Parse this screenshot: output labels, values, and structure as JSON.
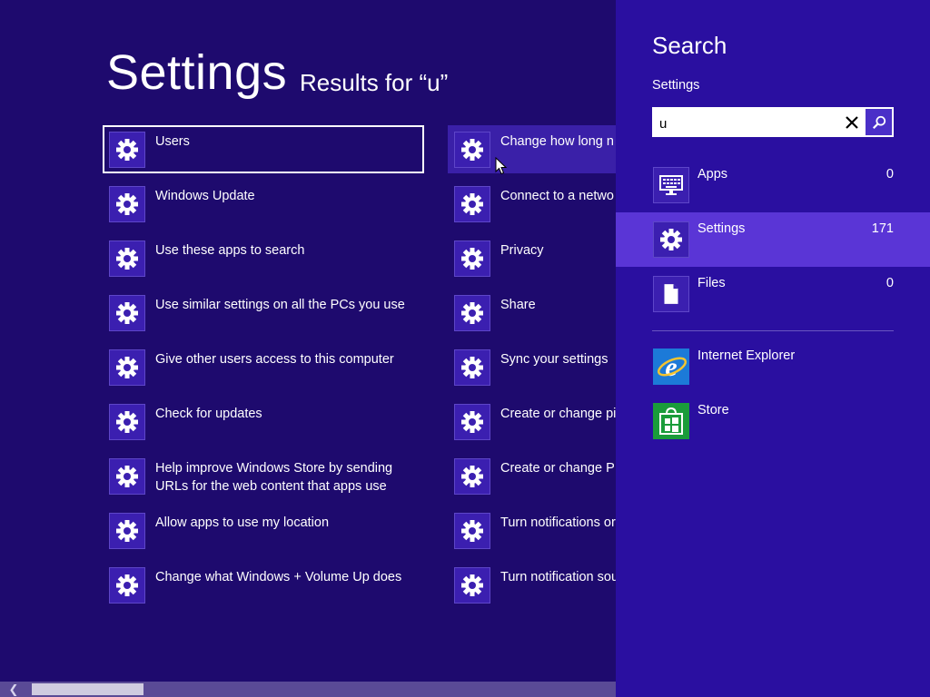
{
  "header": {
    "title": "Settings",
    "subtitle": "Results for “u”"
  },
  "results": {
    "left": [
      {
        "label": "Users"
      },
      {
        "label": "Windows Update"
      },
      {
        "label": "Use these apps to search"
      },
      {
        "label": "Use similar settings on all the PCs you use"
      },
      {
        "label": "Give other users access to this computer"
      },
      {
        "label": "Check for updates"
      },
      {
        "label": "Help improve Windows Store by sending URLs for the web content that apps use"
      },
      {
        "label": "Allow apps to use my location"
      },
      {
        "label": "Change what Windows + Volume Up does"
      }
    ],
    "right": [
      {
        "label": "Change how long n"
      },
      {
        "label": "Connect to a netwo"
      },
      {
        "label": "Privacy"
      },
      {
        "label": "Share"
      },
      {
        "label": "Sync your settings"
      },
      {
        "label": "Create or change pi"
      },
      {
        "label": "Create or change PI"
      },
      {
        "label": "Turn notifications or"
      },
      {
        "label": "Turn notification sou"
      }
    ]
  },
  "search": {
    "title": "Search",
    "scope": "Settings",
    "query": "u",
    "filters": [
      {
        "label": "Apps",
        "count": "0",
        "icon": "apps-icon"
      },
      {
        "label": "Settings",
        "count": "171",
        "icon": "gear-icon"
      },
      {
        "label": "Files",
        "count": "0",
        "icon": "file-icon"
      }
    ],
    "apps": [
      {
        "label": "Internet Explorer",
        "icon": "internet-explorer-icon"
      },
      {
        "label": "Store",
        "icon": "store-icon"
      }
    ]
  },
  "colors": {
    "background": "#1e0a6e",
    "charm_background": "#2a0fa0",
    "highlight": "#5a35d6",
    "tile_icon": "#3b1fb0"
  }
}
